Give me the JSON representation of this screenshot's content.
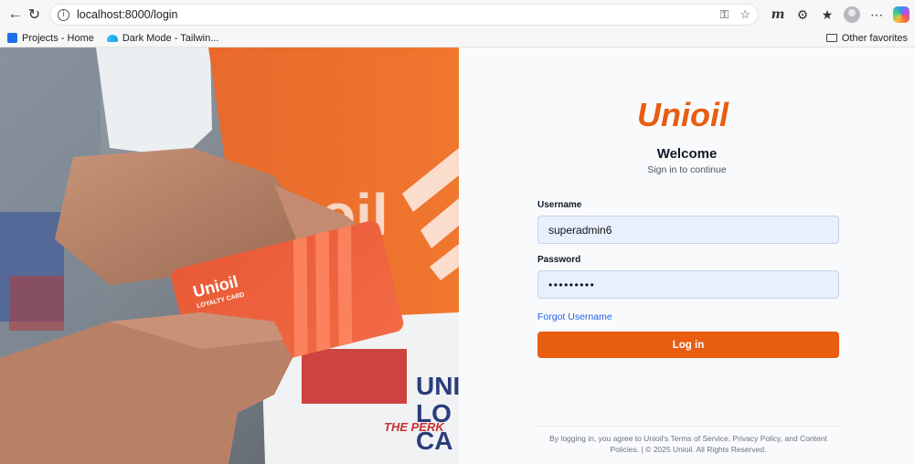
{
  "browser": {
    "url": "localhost:8000/login",
    "bookmarks": [
      "Projects - Home",
      "Dark Mode - Tailwin..."
    ],
    "other_favorites": "Other favorites"
  },
  "hero": {
    "card_brand": "Unioil",
    "card_subtitle": "LOYALTY CARD",
    "banner_lines": [
      "UNI",
      "LO",
      "CA"
    ],
    "banner_tagline": "THE PERK",
    "shirt_text": "oil"
  },
  "login": {
    "logo_text": "Unioil",
    "title": "Welcome",
    "subtitle": "Sign in to continue",
    "username_label": "Username",
    "username_value": "superadmin6",
    "password_label": "Password",
    "password_value": "•••••••••",
    "forgot_label": "Forgot Username",
    "submit_label": "Log in",
    "footer_text": "By logging in, you agree to Unioil's Terms of Service, Privacy Policy, and Content Policies. | © 2025 Unioil. All Rights Reserved."
  },
  "colors": {
    "brand_orange": "#e85d10",
    "link_blue": "#2563eb",
    "field_bg": "#e8f0fe"
  }
}
